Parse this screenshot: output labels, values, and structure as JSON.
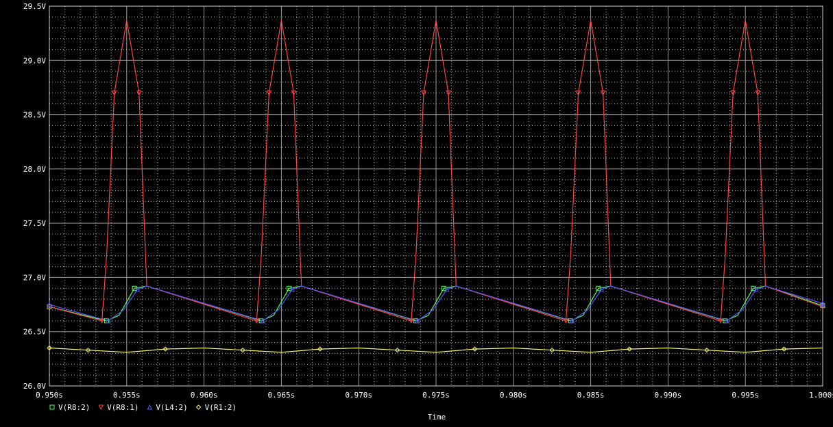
{
  "chart_data": {
    "type": "line",
    "title": "",
    "xlabel": "Time",
    "ylabel": "",
    "xlim": [
      0.95,
      1.0
    ],
    "ylim": [
      26.0,
      29.5
    ],
    "x_ticks": [
      0.95,
      0.955,
      0.96,
      0.965,
      0.97,
      0.975,
      0.98,
      0.985,
      0.99,
      0.995,
      1.0
    ],
    "x_tick_labels": [
      "0.950s",
      "0.955s",
      "0.960s",
      "0.965s",
      "0.970s",
      "0.975s",
      "0.980s",
      "0.985s",
      "0.990s",
      "0.995s",
      "1.000s"
    ],
    "y_ticks": [
      26.0,
      26.5,
      27.0,
      27.5,
      28.0,
      28.5,
      29.0,
      29.5
    ],
    "y_tick_labels": [
      "26.0V",
      "26.5V",
      "27.0V",
      "27.5V",
      "28.0V",
      "28.5V",
      "29.0V",
      "29.5V"
    ],
    "grid": true,
    "background": "#000000",
    "series": [
      {
        "name": "V(R8:2)",
        "color": "#55ff55",
        "marker": "square",
        "x": [
          0.95,
          0.9537,
          0.9545,
          0.9555,
          0.9563,
          0.9637,
          0.9645,
          0.9655,
          0.9663,
          0.9737,
          0.9745,
          0.9755,
          0.9763,
          0.9837,
          0.9845,
          0.9855,
          0.9863,
          0.9937,
          0.9945,
          0.9955,
          0.9963,
          1.0
        ],
        "y": [
          26.73,
          26.6,
          26.65,
          26.9,
          26.92,
          26.6,
          26.65,
          26.9,
          26.92,
          26.6,
          26.65,
          26.9,
          26.92,
          26.6,
          26.65,
          26.9,
          26.92,
          26.6,
          26.65,
          26.9,
          26.92,
          26.74
        ]
      },
      {
        "name": "V(R8:1)",
        "color": "#ff4444",
        "marker": "triangle-down",
        "x": [
          0.95,
          0.9534,
          0.9537,
          0.9542,
          0.955,
          0.9558,
          0.9563,
          0.9634,
          0.9637,
          0.9642,
          0.965,
          0.9658,
          0.9663,
          0.9734,
          0.9737,
          0.9742,
          0.975,
          0.9758,
          0.9763,
          0.9834,
          0.9837,
          0.9842,
          0.985,
          0.9858,
          0.9863,
          0.9934,
          0.9937,
          0.9942,
          0.995,
          0.9958,
          0.9963,
          1.0
        ],
        "y": [
          26.73,
          26.6,
          27.2,
          28.7,
          29.37,
          28.7,
          26.92,
          26.6,
          27.2,
          28.7,
          29.37,
          28.7,
          26.92,
          26.6,
          27.2,
          28.7,
          29.37,
          28.7,
          26.92,
          26.6,
          27.2,
          28.7,
          29.37,
          28.7,
          26.92,
          26.6,
          27.2,
          28.7,
          29.37,
          28.7,
          26.92,
          26.73
        ]
      },
      {
        "name": "V(L4:2)",
        "color": "#5555ff",
        "marker": "triangle-up",
        "x": [
          0.95,
          0.9538,
          0.9548,
          0.9557,
          0.9563,
          0.9638,
          0.9648,
          0.9657,
          0.9663,
          0.9738,
          0.9748,
          0.9757,
          0.9763,
          0.9838,
          0.9848,
          0.9857,
          0.9863,
          0.9938,
          0.9948,
          0.9957,
          0.9963,
          1.0
        ],
        "y": [
          26.75,
          26.6,
          26.7,
          26.89,
          26.92,
          26.6,
          26.7,
          26.89,
          26.92,
          26.6,
          26.7,
          26.89,
          26.92,
          26.6,
          26.7,
          26.89,
          26.92,
          26.6,
          26.7,
          26.89,
          26.92,
          26.76
        ]
      },
      {
        "name": "V(R1:2)",
        "color": "#ffff66",
        "marker": "diamond",
        "x": [
          0.95,
          0.9525,
          0.955,
          0.9575,
          0.96,
          0.9625,
          0.965,
          0.9675,
          0.97,
          0.9725,
          0.975,
          0.9775,
          0.98,
          0.9825,
          0.985,
          0.9875,
          0.99,
          0.9925,
          0.995,
          0.9975,
          1.0
        ],
        "y": [
          26.35,
          26.33,
          26.31,
          26.34,
          26.35,
          26.33,
          26.31,
          26.34,
          26.35,
          26.33,
          26.31,
          26.34,
          26.35,
          26.33,
          26.31,
          26.34,
          26.35,
          26.33,
          26.31,
          26.34,
          26.35
        ]
      }
    ]
  }
}
